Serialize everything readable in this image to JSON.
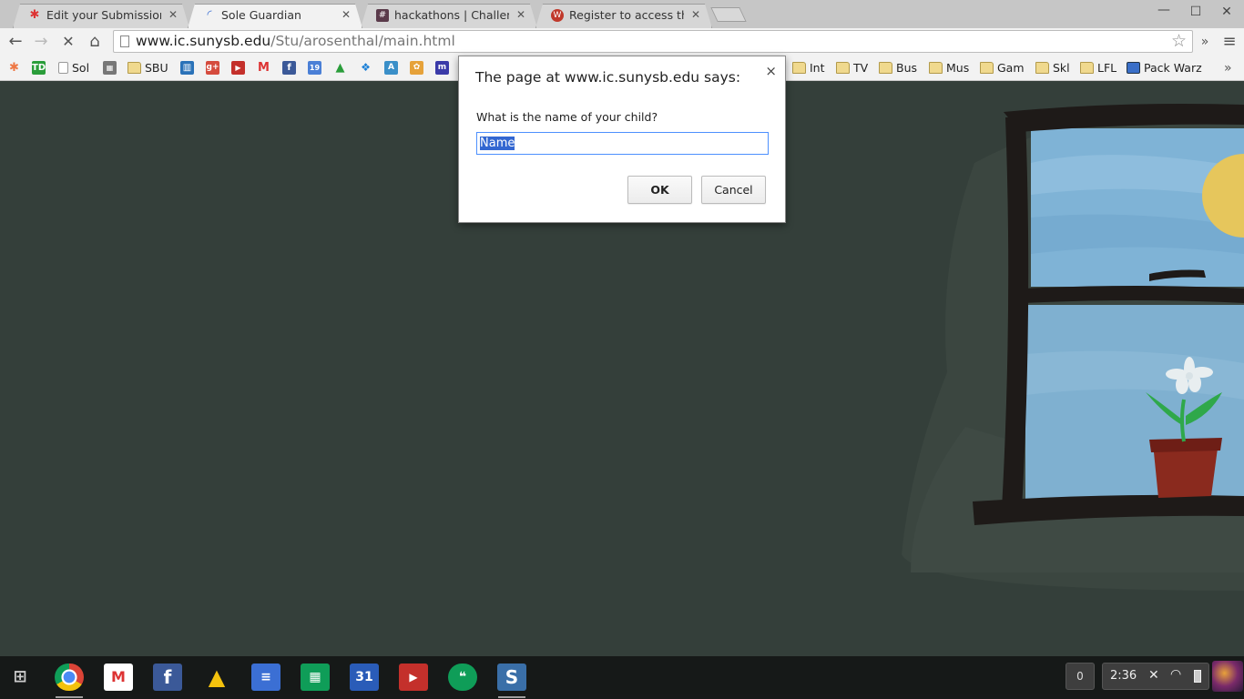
{
  "tabs": [
    {
      "title": "Edit your Submission | U",
      "favicon": "pinwheel-icon",
      "active": false
    },
    {
      "title": "Sole Guardian",
      "favicon": "loading-spinner-icon",
      "active": true
    },
    {
      "title": "hackathons | ChallengeF",
      "favicon": "hash-icon",
      "active": false
    },
    {
      "title": "Register to access the in",
      "favicon": "w-logo-icon",
      "active": false
    }
  ],
  "toolbar": {
    "url_host": "www.ic.sunysb.edu",
    "url_path": "/Stu/arosenthal/main.html"
  },
  "bookmarks": {
    "labeled": [
      {
        "label": "Sol",
        "icon": "page-icon"
      },
      {
        "label": "SBU",
        "icon": "folder-icon"
      },
      {
        "label": "Int",
        "icon": "folder-icon"
      },
      {
        "label": "TV",
        "icon": "folder-icon"
      },
      {
        "label": "Bus",
        "icon": "folder-icon"
      },
      {
        "label": "Mus",
        "icon": "folder-icon"
      },
      {
        "label": "Gam",
        "icon": "folder-icon"
      },
      {
        "label": "Skl",
        "icon": "folder-icon"
      },
      {
        "label": "LFL",
        "icon": "folder-icon"
      },
      {
        "label": "Pack Warz",
        "icon": "calendar-icon"
      }
    ],
    "icon_only": [
      "pinwheel-icon",
      "td-icon",
      "kaplan-icon",
      "trello-icon",
      "google-plus-icon",
      "youtube-icon",
      "gmail-icon",
      "facebook-icon",
      "calendar-19-icon",
      "drive-icon",
      "dropbox-icon",
      "translate-icon",
      "photos-icon",
      "m-icon"
    ],
    "calendar_day": "19",
    "overflow": "»"
  },
  "dialog": {
    "title": "The page at www.ic.sunysb.edu says:",
    "message": "What is the name of your child?",
    "input_value": "Name",
    "ok_label": "OK",
    "cancel_label": "Cancel",
    "close_glyph": "×"
  },
  "shelf": {
    "apps": [
      "launcher-icon",
      "chrome-icon",
      "gmail-icon",
      "facebook-icon",
      "drive-icon",
      "docs-icon",
      "sheets-icon",
      "calendar-icon",
      "youtube-icon",
      "hangouts-icon",
      "sole-guardian-icon"
    ],
    "calendar_day": "31",
    "notification_count": "0",
    "clock": "2:36"
  },
  "colors": {
    "page_bg": "#343f3a",
    "sky": "#7fb3d6",
    "sun": "#e6c65c",
    "frame": "#1e1a18",
    "accent_focus": "#4d90fe"
  }
}
